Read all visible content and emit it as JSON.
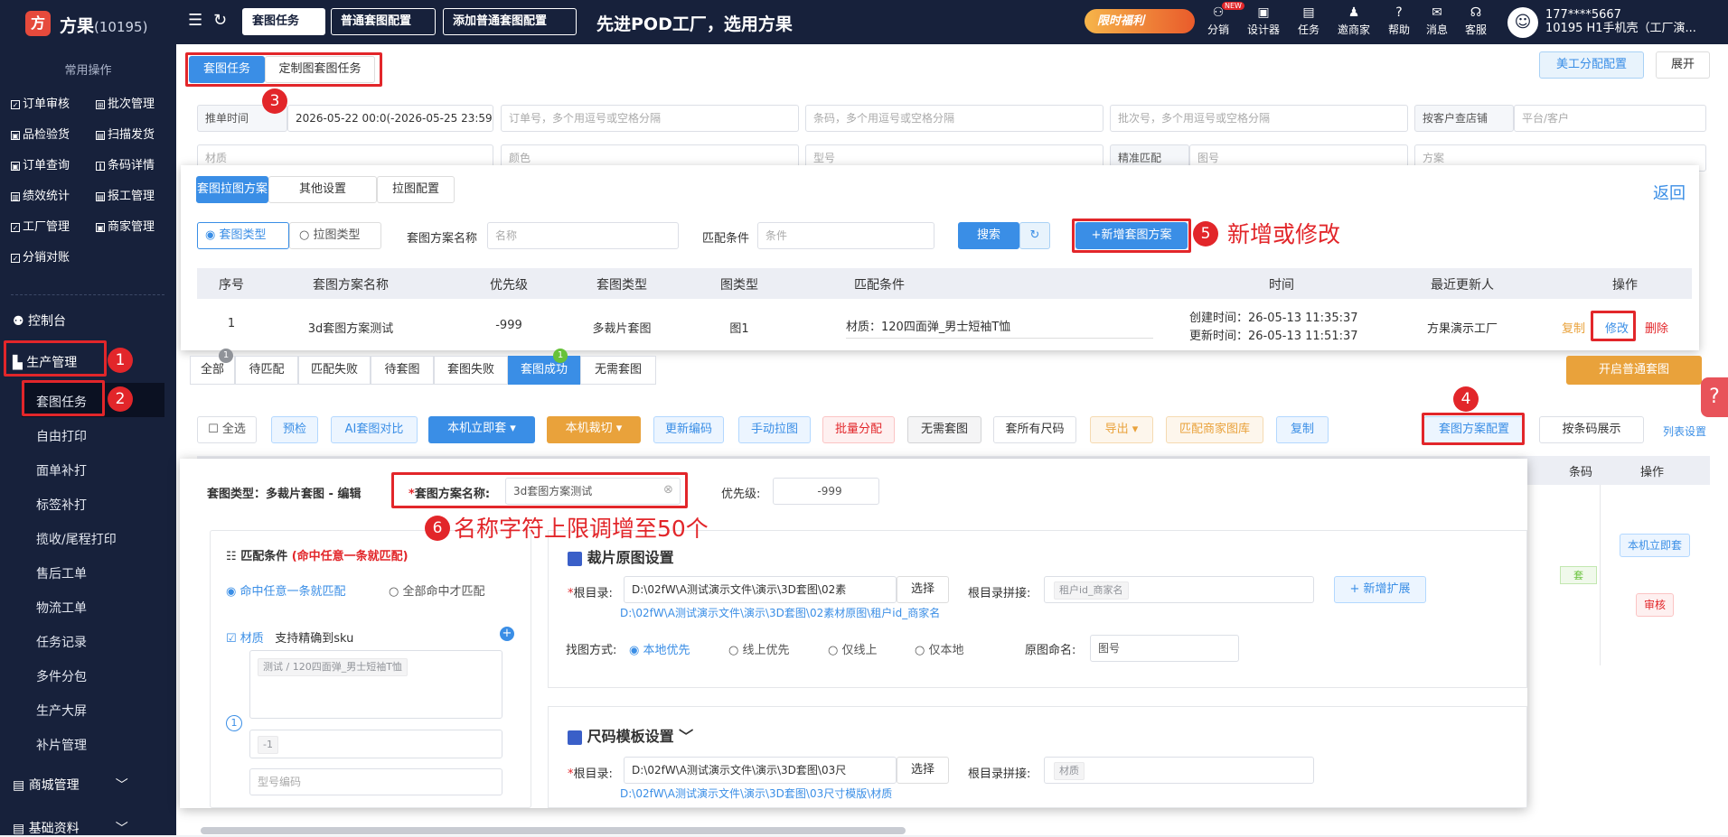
{
  "app": {
    "logo_letter": "方",
    "name": "方果",
    "id": "(10195)",
    "slogan": "先进POD工厂，选用方果",
    "promo": "限时福利"
  },
  "top_tabs": [
    "套图任务",
    "普通套图配置",
    "添加普通套图配置"
  ],
  "top_nav": [
    {
      "icon": "share-icon",
      "label": "分销",
      "badge": "NEW"
    },
    {
      "icon": "designer-icon",
      "label": "设计器"
    },
    {
      "icon": "task-icon",
      "label": "任务"
    },
    {
      "icon": "invite-icon",
      "label": "邀商家"
    },
    {
      "icon": "help-icon",
      "label": "帮助"
    },
    {
      "icon": "message-icon",
      "label": "消息"
    },
    {
      "icon": "service-icon",
      "label": "客服"
    }
  ],
  "user": {
    "phone": "177****5667",
    "org": "10195 H1手机壳（工厂演..."
  },
  "sidebar": {
    "section": "常用操作",
    "quick": [
      "订单审核",
      "批次管理",
      "品检验货",
      "扫描发货",
      "订单查询",
      "条码详情",
      "绩效统计",
      "报工管理",
      "工厂管理",
      "商家管理",
      "分销对账"
    ],
    "menu": {
      "console": "控制台",
      "production": "生产管理",
      "mall": "商城管理",
      "base": "基础资料"
    },
    "sub": [
      "套图任务",
      "自由打印",
      "面单补打",
      "标签补打",
      "揽收/尾程打印",
      "售后工单",
      "物流工单",
      "任务记录",
      "多件分包",
      "生产大屏",
      "补片管理"
    ]
  },
  "main": {
    "tabs": [
      "套图任务",
      "定制图套图任务"
    ],
    "art_btn": "美工分配配置",
    "expand": "展开",
    "filters": {
      "time_label": "推单时间",
      "time_value": "2026-05-22 00:0(-2026-05-25 23:59",
      "order_ph": "订单号，多个用逗号或空格分隔",
      "barcode_ph": "条码，多个用逗号或空格分隔",
      "batch_ph": "批次号，多个用逗号或空格分隔",
      "shop_sel": "按客户查店铺",
      "platform_ph": "平台/客户",
      "material_ph": "材质",
      "color_ph": "颜色",
      "model_ph": "型号",
      "match_sel": "精准匹配",
      "pic_ph": "图号",
      "plan_ph": "方案"
    }
  },
  "panel": {
    "tabs": [
      "套图拉图方案",
      "其他设置",
      "拉图配置"
    ],
    "back": "返回",
    "radio": [
      "套图类型",
      "拉图类型"
    ],
    "name_label": "套图方案名称",
    "name_ph": "名称",
    "cond_label": "匹配条件",
    "cond_ph": "条件",
    "search": "搜索",
    "add": "+新增套图方案",
    "columns": [
      "序号",
      "套图方案名称",
      "优先级",
      "套图类型",
      "图类型",
      "匹配条件",
      "时间",
      "最近更新人",
      "操作"
    ],
    "row": {
      "no": "1",
      "name": "3d套图方案测试",
      "priority": "-999",
      "type": "多裁片套图",
      "pic_type": "图1",
      "cond": "材质：120四面弹_男士短袖T恤",
      "created": "创建时间：26-05-13 11:35:37",
      "updated": "更新时间：26-05-13 11:51:37",
      "updater": "方果演示工厂",
      "ops": [
        "复制",
        "修改",
        "删除"
      ]
    }
  },
  "status_tabs": [
    {
      "label": "全部",
      "count": "1"
    },
    {
      "label": "待匹配"
    },
    {
      "label": "匹配失败"
    },
    {
      "label": "待套图"
    },
    {
      "label": "套图失败"
    },
    {
      "label": "套图成功",
      "count": "1"
    },
    {
      "label": "无需套图"
    }
  ],
  "open_btn": "开启普通套图",
  "actions": [
    {
      "label": "全选"
    },
    {
      "label": "预检"
    },
    {
      "label": "AI套图对比"
    },
    {
      "label": "本机立即套 ▾"
    },
    {
      "label": "本机裁切 ▾"
    },
    {
      "label": "更新编码"
    },
    {
      "label": "手动拉图"
    },
    {
      "label": "批量分配"
    },
    {
      "label": "无需套图"
    },
    {
      "label": "套所有尺码"
    },
    {
      "label": "导出 ▾"
    },
    {
      "label": "匹配商家图库"
    },
    {
      "label": "复制"
    }
  ],
  "right_actions": {
    "config": "套图方案配置",
    "show": "按条码展示",
    "col_set": "列表设置"
  },
  "grid": {
    "col_barcode": "条码",
    "col_op": "操作",
    "btn_now": "本机立即套",
    "btn_audit": "审核",
    "tag": "套"
  },
  "dialog": {
    "title": "套图类型：多裁片套图 - 编辑",
    "name_label": "套图方案名称:",
    "name_value": "3d套图方案测试",
    "priority_label": "优先级:",
    "priority_value": "-999",
    "match_title": "匹配条件",
    "match_hint": "(命中任意一条就匹配)",
    "radios": [
      "命中任意一条就匹配",
      "全部命中才匹配"
    ],
    "material": "材质",
    "support": "支持精确到sku",
    "tag1": "测试 / 120四面弹_男士短袖T恤",
    "tag2": "-1",
    "model_ph": "型号编码",
    "num": "1",
    "sec1": "裁片原图设置",
    "root_label": "根目录:",
    "root1": "D:\\02fW\\A测试演示文件\\演示\\3D套图\\02素",
    "choose": "选择",
    "join_label": "根目录拼接:",
    "join_tag": "租户id_商家名",
    "add_ext": "+ 新增扩展",
    "path1": "D:\\02fW\\A测试演示文件\\演示\\3D套图\\02素材原图\\租户id_商家名",
    "find_label": "找图方式:",
    "find": [
      "本地优先",
      "线上优先",
      "仅线上",
      "仅本地"
    ],
    "orig_label": "原图命名:",
    "orig_value": "图号",
    "sec2": "尺码模板设置",
    "root2": "D:\\02fW\\A测试演示文件\\演示\\3D套图\\03尺",
    "join_tag2": "材质",
    "path2": "D:\\02fW\\A测试演示文件\\演示\\3D套图\\03尺寸模版\\材质"
  },
  "annotations": {
    "a1": "1",
    "a2": "2",
    "a3": "3",
    "a4": "4",
    "a5": "5",
    "a5_text": "新增或修改",
    "a6": "6",
    "a6_text": "名称字符上限调增至50个"
  },
  "colors": {
    "primary": "#3a8ee6",
    "dark": "#17213b",
    "annotation": "#e2262a",
    "orange": "#e9a23b"
  }
}
